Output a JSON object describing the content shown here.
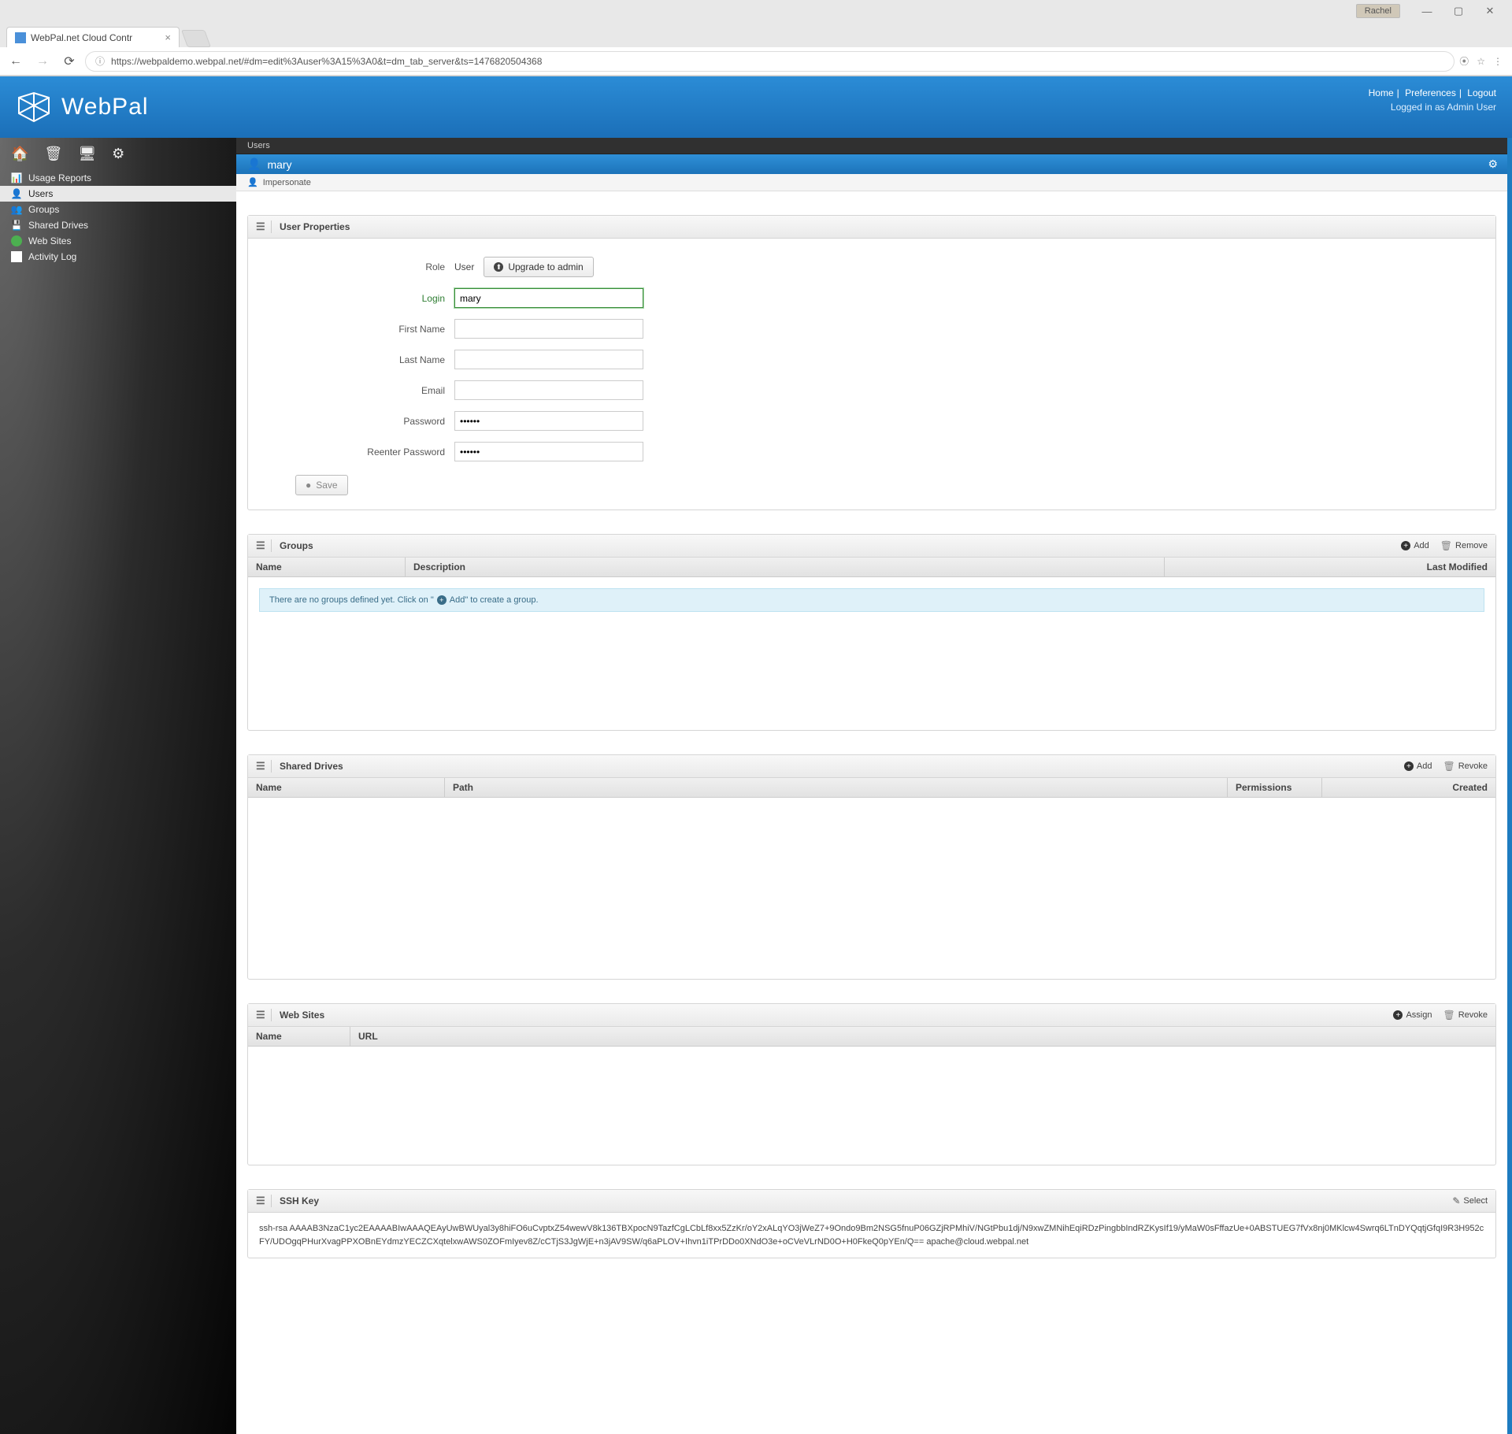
{
  "browser": {
    "os_user": "Rachel",
    "tab_title": "WebPal.net Cloud Contr",
    "url": "https://webpaldemo.webpal.net/#dm=edit%3Auser%3A15%3A0&t=dm_tab_server&ts=1476820504368"
  },
  "header": {
    "brand": "WebPal",
    "links": {
      "home": "Home",
      "preferences": "Preferences",
      "logout": "Logout"
    },
    "login_status": "Logged in as Admin User"
  },
  "sidebar": {
    "items": [
      {
        "label": "Usage Reports"
      },
      {
        "label": "Users"
      },
      {
        "label": "Groups"
      },
      {
        "label": "Shared Drives"
      },
      {
        "label": "Web Sites"
      },
      {
        "label": "Activity Log"
      }
    ]
  },
  "breadcrumb": "Users",
  "page": {
    "title": "mary",
    "impersonate": "Impersonate"
  },
  "user_props": {
    "panel_title": "User Properties",
    "role_label": "Role",
    "role_value": "User",
    "upgrade_btn": "Upgrade to admin",
    "login_label": "Login",
    "login_value": "mary",
    "first_name_label": "First Name",
    "last_name_label": "Last Name",
    "email_label": "Email",
    "password_label": "Password",
    "password_value": "••••••",
    "reenter_label": "Reenter Password",
    "reenter_value": "••••••",
    "save_btn": "Save"
  },
  "groups": {
    "panel_title": "Groups",
    "add": "Add",
    "remove": "Remove",
    "cols": {
      "name": "Name",
      "description": "Description",
      "last_modified": "Last Modified"
    },
    "empty_pre": "There are no groups defined yet. Click on \"",
    "empty_post": " Add\" to create a group."
  },
  "drives": {
    "panel_title": "Shared Drives",
    "add": "Add",
    "revoke": "Revoke",
    "cols": {
      "name": "Name",
      "path": "Path",
      "permissions": "Permissions",
      "created": "Created"
    }
  },
  "websites": {
    "panel_title": "Web Sites",
    "assign": "Assign",
    "revoke": "Revoke",
    "cols": {
      "name": "Name",
      "url": "URL"
    }
  },
  "ssh": {
    "panel_title": "SSH Key",
    "select": "Select",
    "key": "ssh-rsa AAAAB3NzaC1yc2EAAAABIwAAAQEAyUwBWUyal3y8hiFO6uCvptxZ54wewV8k136TBXpocN9TazfCgLCbLf8xx5ZzKr/oY2xALqYO3jWeZ7+9Ondo9Bm2NSG5fnuP06GZjRPMhiV/NGtPbu1dj/N9xwZMNihEqiRDzPingbbIndRZKysIf19/yMaW0sFffazUe+0ABSTUEG7fVx8nj0MKlcw4Swrq6LTnDYQqtjGfqI9R3H952cFY/UDOgqPHurXvagPPXOBnEYdmzYECZCXqtelxwAWS0ZOFmIyev8Z/cCTjS3JgWjE+n3jAV9SW/q6aPLOV+Ihvn1iTPrDDo0XNdO3e+oCVeVLrND0O+H0FkeQ0pYEn/Q== apache@cloud.webpal.net"
  }
}
